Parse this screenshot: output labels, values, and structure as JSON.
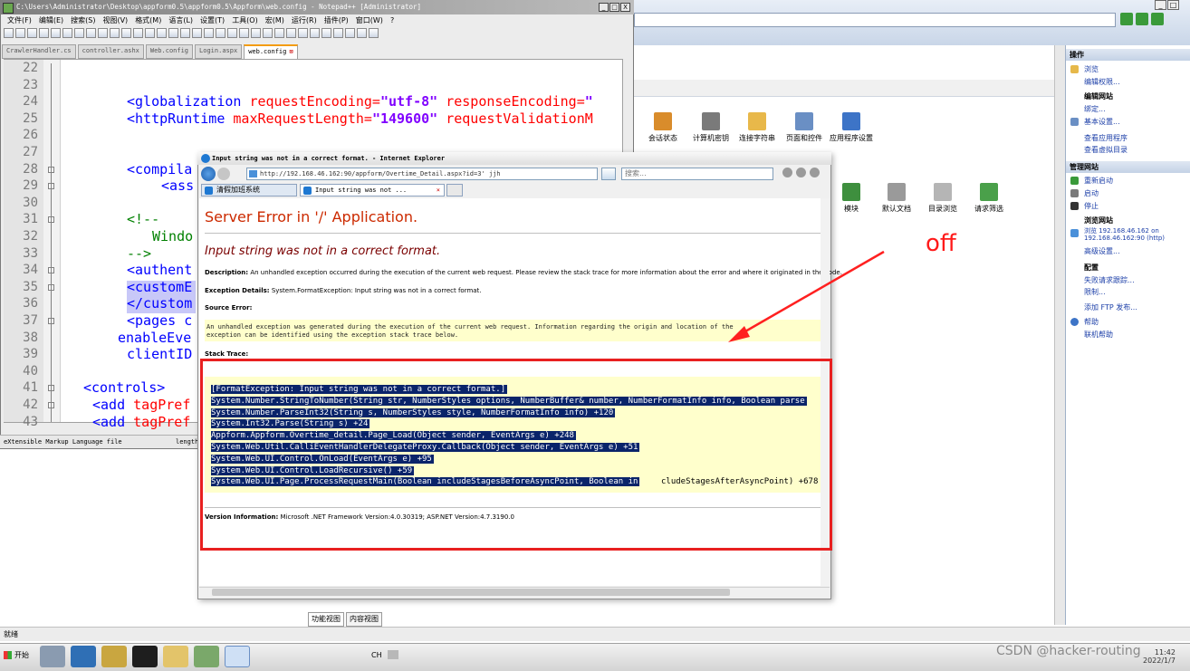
{
  "notepad": {
    "title": "C:\\Users\\Administrator\\Desktop\\appform0.5\\appform0.5\\Appform\\web.config - Notepad++ [Administrator]",
    "window_controls": [
      "_",
      "□",
      "X"
    ],
    "menu": [
      "文件(F)",
      "编辑(E)",
      "搜索(S)",
      "视图(V)",
      "格式(M)",
      "语言(L)",
      "设置(T)",
      "工具(O)",
      "宏(M)",
      "运行(R)",
      "插件(P)",
      "窗口(W)",
      "?"
    ],
    "tabs": [
      "CrawlerHandler.cs",
      "controller.ashx",
      "Web.config",
      "Login.aspx",
      "web.config"
    ],
    "code_lines": [
      {
        "n": "22",
        "text": ""
      },
      {
        "n": "23",
        "text": ""
      },
      {
        "n": "24",
        "tag": "<globalization",
        "attr1": " requestEncoding=",
        "val1": "\"utf-8\"",
        "attr2": " responseEncoding=",
        "val2": "\""
      },
      {
        "n": "25",
        "tag": "<httpRuntime",
        "attr1": " maxRequestLength=",
        "val1": "\"149600\"",
        "attr2": " requestValidationM",
        "val2": ""
      },
      {
        "n": "26",
        "text": ""
      },
      {
        "n": "27",
        "text": ""
      },
      {
        "n": "28",
        "tag": "<compila",
        "attr1": "",
        "val1": "",
        "attr2": "",
        "val2": ""
      },
      {
        "n": "29",
        "tag": "<ass",
        "attr1": "",
        "val1": "",
        "attr2": "",
        "val2": ""
      },
      {
        "n": "30",
        "text": ""
      },
      {
        "n": "31",
        "cm": "<!--"
      },
      {
        "n": "32",
        "cm": "Windo"
      },
      {
        "n": "33",
        "cm": "-->"
      },
      {
        "n": "34",
        "tag": "<authent",
        "attr1": "",
        "val1": "",
        "attr2": "",
        "val2": ""
      },
      {
        "n": "35",
        "tag": "<customE",
        "attr1": "",
        "val1": "",
        "attr2": "",
        "val2": ""
      },
      {
        "n": "36",
        "tag": "</custom",
        "attr1": "",
        "val1": "",
        "attr2": "",
        "val2": ""
      },
      {
        "n": "37",
        "tag": "<pages c",
        "attr1": "",
        "val1": "",
        "attr2": "",
        "val2": ""
      },
      {
        "n": "38",
        "tag": "enableEve",
        "attr1": "",
        "val1": "",
        "attr2": "",
        "val2": ""
      },
      {
        "n": "39",
        "tag": "clientID",
        "attr1": "",
        "val1": "",
        "attr2": "",
        "val2": ""
      },
      {
        "n": "40",
        "text": ""
      },
      {
        "n": "41",
        "tag": "<controls>",
        "attr1": "",
        "val1": "",
        "attr2": "",
        "val2": ""
      },
      {
        "n": "42",
        "tag": "<add",
        "attr1": " tagPref",
        "val1": "",
        "attr2": "",
        "val2": ""
      },
      {
        "n": "43",
        "tag": "<add",
        "attr1": " tagPref",
        "val1": "",
        "attr2": "",
        "val2": ""
      }
    ],
    "status_left": "eXtensible Markup Language file",
    "status_right": "length"
  },
  "ie": {
    "title": "Input string was not in a correct format. - Internet Explorer",
    "address": "http://192.168.46.162:90/appform/Overtime_Detail.aspx?id=3' jjh",
    "search_placeholder": "搜索...",
    "tab_favorite": "清假加班系统",
    "tab_active": "Input string was not ...",
    "tab_close": "×"
  },
  "error_page": {
    "heading": "Server Error in '/' Application.",
    "message": "Input string was not in a correct format.",
    "description_label": "Description:",
    "description_text": "An unhandled exception occurred during the execution of the current web request. Please review the stack trace for more information about the error and where it originated in the code.",
    "exception_label": "Exception Details:",
    "exception_text": "System.FormatException: Input string was not in a correct format.",
    "source_error_label": "Source Error:",
    "source_error_lines": [
      "An unhandled exception was generated during the execution of the current web request. Information regarding the origin and location of the",
      "exception can be identified using the exception stack trace below."
    ],
    "stack_trace_label": "Stack Trace:",
    "stack_trace_lines": [
      "[FormatException: Input string was not in a correct format.]",
      "   System.Number.StringToNumber(String str, NumberStyles options, NumberBuffer& number, NumberFormatInfo info, Boolean parse",
      "   System.Number.ParseInt32(String s, NumberStyles style, NumberFormatInfo info) +120",
      "   System.Int32.Parse(String s) +24",
      "   Appform.Appform.Overtime_detail.Page_Load(Object sender, EventArgs e) +248",
      "   System.Web.Util.CalliEventHandlerDelegateProxy.Callback(Object sender, EventArgs e) +51",
      "   System.Web.UI.Control.OnLoad(EventArgs e) +95",
      "   System.Web.UI.Control.LoadRecursive() +59",
      "   System.Web.UI.Page.ProcessRequestMain(Boolean includeStagesBeforeAsyncPoint, Boolean in"
    ],
    "stack_trace_tail": "cludeStagesAfterAsyncPoint) +678",
    "version_label": "Version Information:",
    "version_text": "Microsoft .NET Framework Version:4.0.30319; ASP.NET Version:4.7.3190.0"
  },
  "iis": {
    "features_row1": [
      "会话状态",
      "计算机密钥",
      "连接字符串",
      "页面和控件",
      "应用程序设置"
    ],
    "features_row2": [
      "模块",
      "默认文档",
      "目录浏览",
      "请求筛选"
    ],
    "actions_header": "操作",
    "actions": [
      {
        "label": "浏览",
        "kind": "link"
      },
      {
        "label": "编辑权限...",
        "kind": "link"
      },
      {
        "label": "编辑网站",
        "kind": "bold"
      },
      {
        "label": "绑定...",
        "kind": "link"
      },
      {
        "label": "基本设置...",
        "kind": "link"
      },
      {
        "label": "查看应用程序",
        "kind": "link"
      },
      {
        "label": "查看虚拟目录",
        "kind": "link"
      }
    ],
    "manage_header": "管理网站",
    "manage_actions": [
      {
        "label": "重新启动",
        "kind": "link"
      },
      {
        "label": "启动",
        "kind": "link"
      },
      {
        "label": "停止",
        "kind": "link"
      },
      {
        "label": "浏览网站",
        "kind": "bold"
      },
      {
        "label": "浏览 192.168.46.162 on",
        "kind": "link"
      },
      {
        "label": "192.168.46.162:90 (http)",
        "kind": "link"
      },
      {
        "label": "高级设置...",
        "kind": "link"
      },
      {
        "label": "配置",
        "kind": "bold"
      },
      {
        "label": "失败请求跟踪...",
        "kind": "link"
      },
      {
        "label": "限制...",
        "kind": "link"
      },
      {
        "label": "添加 FTP 发布...",
        "kind": "link"
      },
      {
        "label": "帮助",
        "kind": "link"
      },
      {
        "label": "联机帮助",
        "kind": "link"
      }
    ],
    "bottom_tabs": [
      "功能视图",
      "内容视图"
    ],
    "status": "就绪"
  },
  "taskbar": {
    "start": "开始",
    "lang": "CH",
    "clock_time": "11:42",
    "clock_date": "2022/1/7"
  },
  "annotation": {
    "label": "off",
    "color": "#ff1a1a"
  },
  "watermark": "CSDN @hacker-routing"
}
